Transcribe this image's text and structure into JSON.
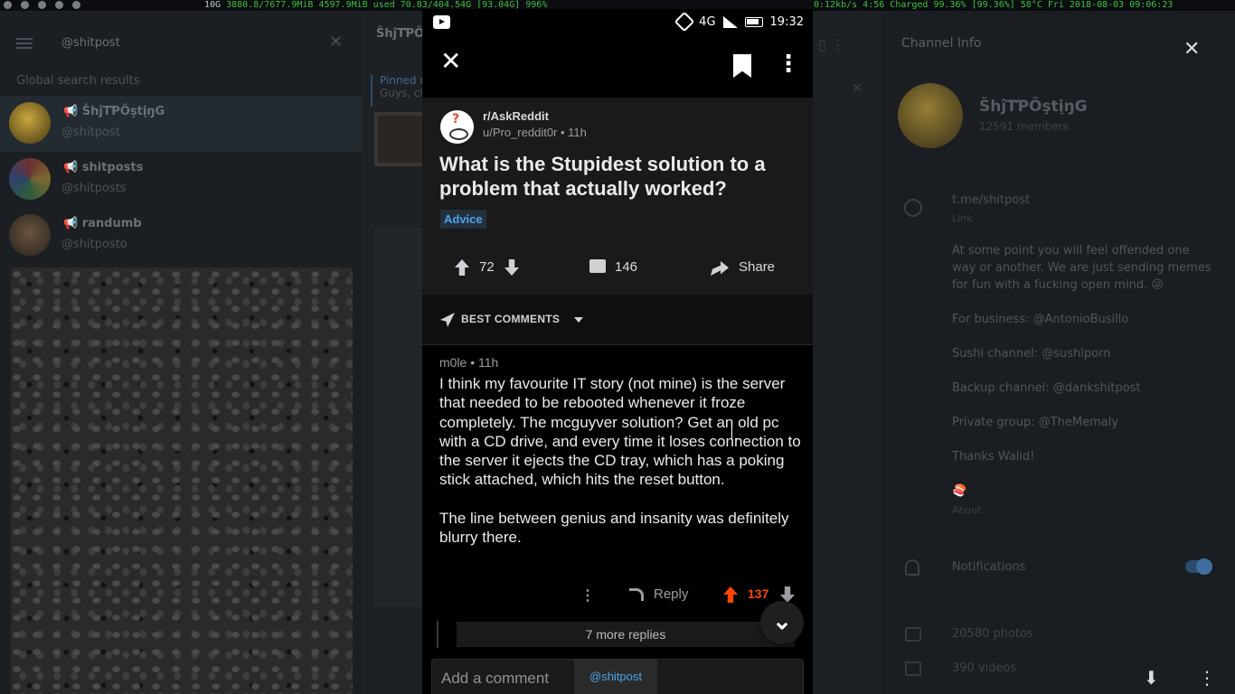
{
  "system_bar": {
    "left": "10G",
    "memory": "3880.8/7677.9MiB",
    "swap": "4597.9MiB used",
    "net": "70.83/404.54G [93.04G] 996%",
    "right": "0:12kb/s 4:56  Charged 99.36% [99.36%]  58°C  Fri 2018-08-03 09:06:23"
  },
  "telegram": {
    "search": {
      "query": "@shitpost",
      "global_results_label": "Global search results"
    },
    "results": [
      {
        "name": "ŠhĵTƤÕştįŋǤ",
        "handle": "@shitpost",
        "selected": true
      },
      {
        "name": "shitposts",
        "handle": "@shitposts",
        "selected": false
      },
      {
        "name": "randumb",
        "handle": "@shitposto",
        "selected": false
      }
    ],
    "chat": {
      "title": "ŠhĵTƤÕştįŋǤ",
      "pinned_title": "Pinned m",
      "pinned_text": "Guys, ch"
    },
    "channel_info": {
      "header": "Channel Info",
      "name": "ŠhĵTƤÕştįŋǤ",
      "members": "12591 members",
      "link": "t.me/shitpost",
      "link_sub": "Link",
      "description": "At some point you will feel offended one way or another. We are just sending memes for fun with a fucking open mind. 😜\n\nFor business: @AntonioBusillo\n\nSushi channel: @sushiporn\n\nBackup channel: @dankshitpost\n\nPrivate group: @TheMemaly\n\nThanks Walid!\n\n🍣",
      "about_label": "About",
      "notifications": "Notifications",
      "photos": "20580 photos",
      "videos": "390 videos"
    }
  },
  "phone": {
    "status": {
      "network": "4G",
      "time": "19:32"
    },
    "post": {
      "subreddit": "r/AskReddit",
      "meta": "u/Pro_reddit0r • 11h",
      "title": "What is the Stupidest solution to a problem that actually worked?",
      "flair": "Advice",
      "votes": "72",
      "comments": "146",
      "share": "Share"
    },
    "sort": {
      "label": "BEST COMMENTS"
    },
    "comment": {
      "author_meta": "m0le • 11h",
      "paragraph1": "I think my favourite IT story (not mine) is the server that needed to be rebooted whenever it froze completely. The mcguyver solution? Get an old pc with a CD drive, and every time it loses connection to the server it ejects the CD tray, which has a poking stick attached, which hits the reset button.",
      "paragraph2": "The line between genius and insanity was definitely blurry there.",
      "reply": "Reply",
      "score": "137",
      "more_replies": "7 more replies"
    },
    "composer": {
      "placeholder": "Add a comment",
      "mention": "@shitpost"
    }
  }
}
